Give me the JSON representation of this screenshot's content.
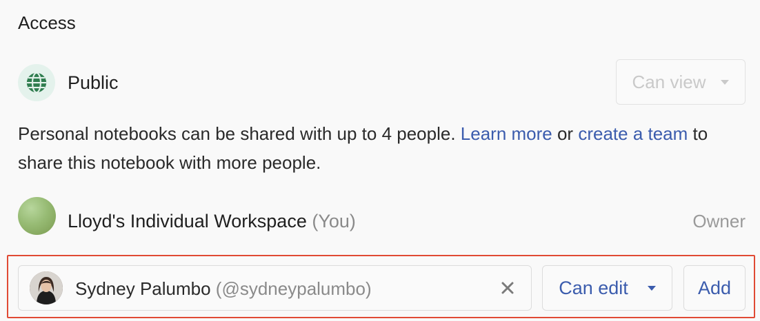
{
  "section": {
    "title": "Access"
  },
  "public_row": {
    "icon": "globe-icon",
    "label": "Public",
    "permission": "Can view",
    "permission_disabled": true
  },
  "notice": {
    "text_1": "Personal notebooks can be shared with up to 4 people. ",
    "link_learn_more": "Learn more",
    "text_2": " or ",
    "link_create_team": "create a team",
    "text_3": " to share this notebook with more people."
  },
  "owner_row": {
    "name": "Lloyd's Individual Workspace",
    "you_tag": "(You)",
    "role": "Owner"
  },
  "invite": {
    "invitee_name": "Sydney Palumbo",
    "invitee_handle": "(@sydneypalumbo)",
    "permission": "Can edit",
    "add_label": "Add"
  },
  "colors": {
    "accent": "#3b5cad",
    "highlight": "#e04a34",
    "globe_bg": "#e4f2ec",
    "globe_fg": "#2f7d4f"
  }
}
